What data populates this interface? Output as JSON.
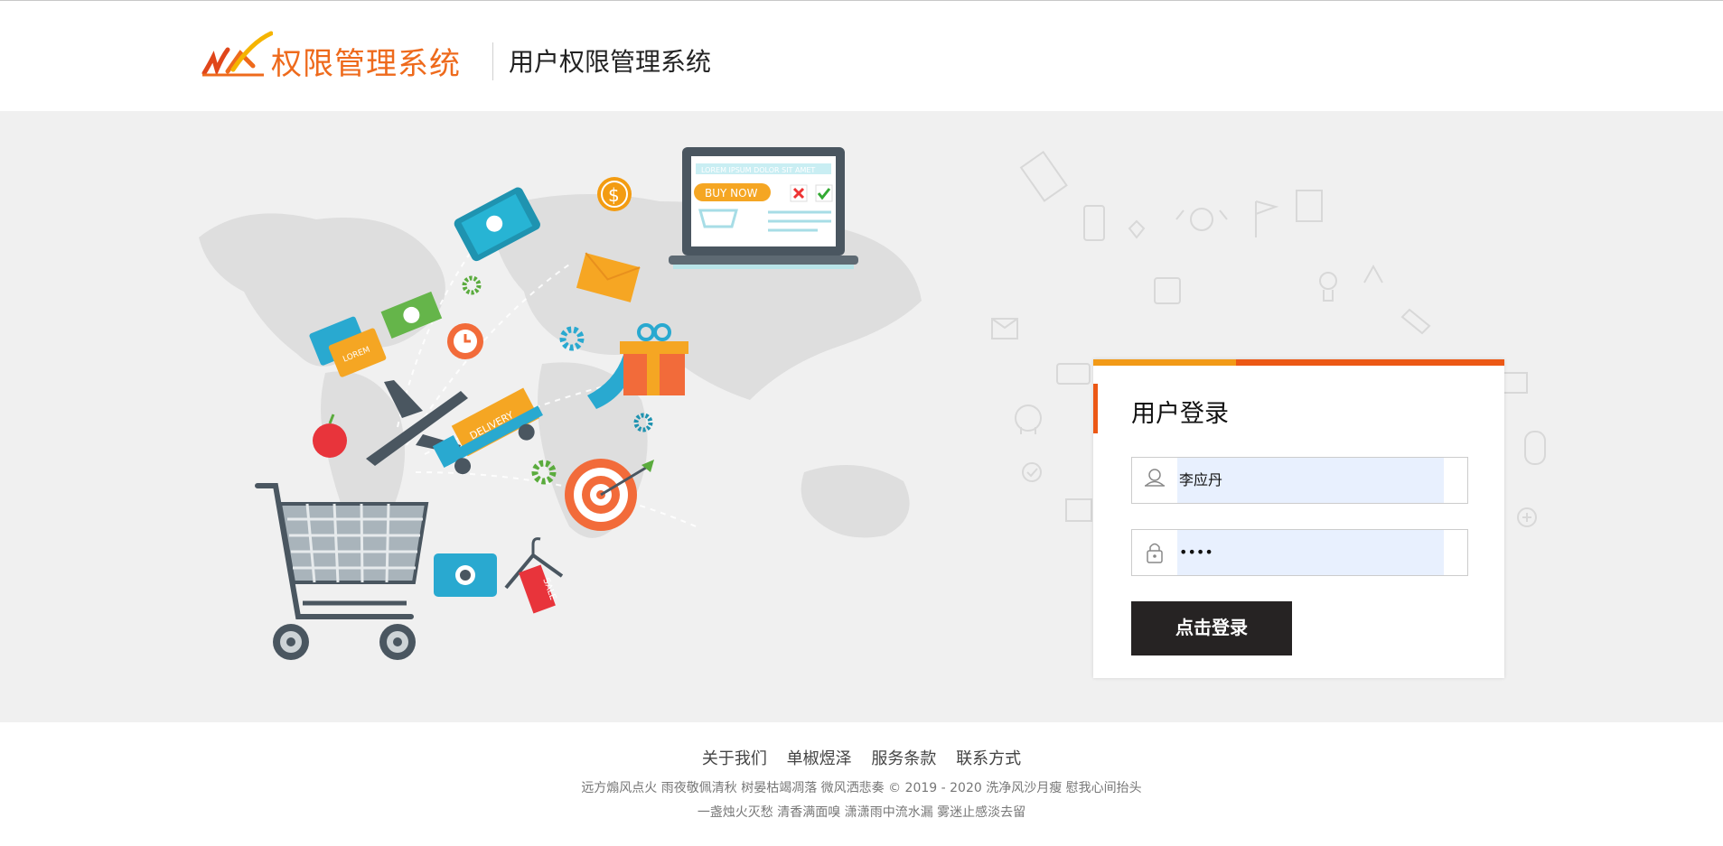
{
  "header": {
    "logo_text": "权限管理系统",
    "subtitle": "用户权限管理系统"
  },
  "illustration": {
    "laptop_banner": "LOREM IPSUM DOLOR SIT AMET",
    "buy_now": "BUY NOW",
    "card_label": "LOREM",
    "delivery_label": "DELIVERY",
    "sale_label": "SALE",
    "dollar": "$"
  },
  "login": {
    "title": "用户登录",
    "username_value": "李应丹",
    "password_value": "••••",
    "submit_label": "点击登录"
  },
  "footer": {
    "links": [
      "关于我们",
      "单椒煜泽",
      "服务条款",
      "联系方式"
    ],
    "line1": "远方煽风点火 雨夜敬佩清秋  树晏枯竭凋落  微风洒悲奏 © 2019 - 2020 洗净风沙月瘦 慰我心间抬头",
    "line2": "一盏烛火灭愁 清香满面嗅 潇潇雨中流水漏 雾迷止感淡去留"
  },
  "colors": {
    "brand_orange": "#ee6a1c",
    "bar_light": "#f29a17",
    "bar_dark": "#ec5815",
    "button_bg": "#262323",
    "autofill_bg": "#e8f0fe"
  },
  "icons": [
    "user-icon",
    "lock-icon",
    "shopping-cart-icon",
    "laptop-icon",
    "airplane-icon",
    "gift-icon",
    "target-icon",
    "phone-icon",
    "mail-icon",
    "camera-icon",
    "apple-icon",
    "gear-icon",
    "alarm-clock-icon",
    "delivery-truck-icon"
  ]
}
